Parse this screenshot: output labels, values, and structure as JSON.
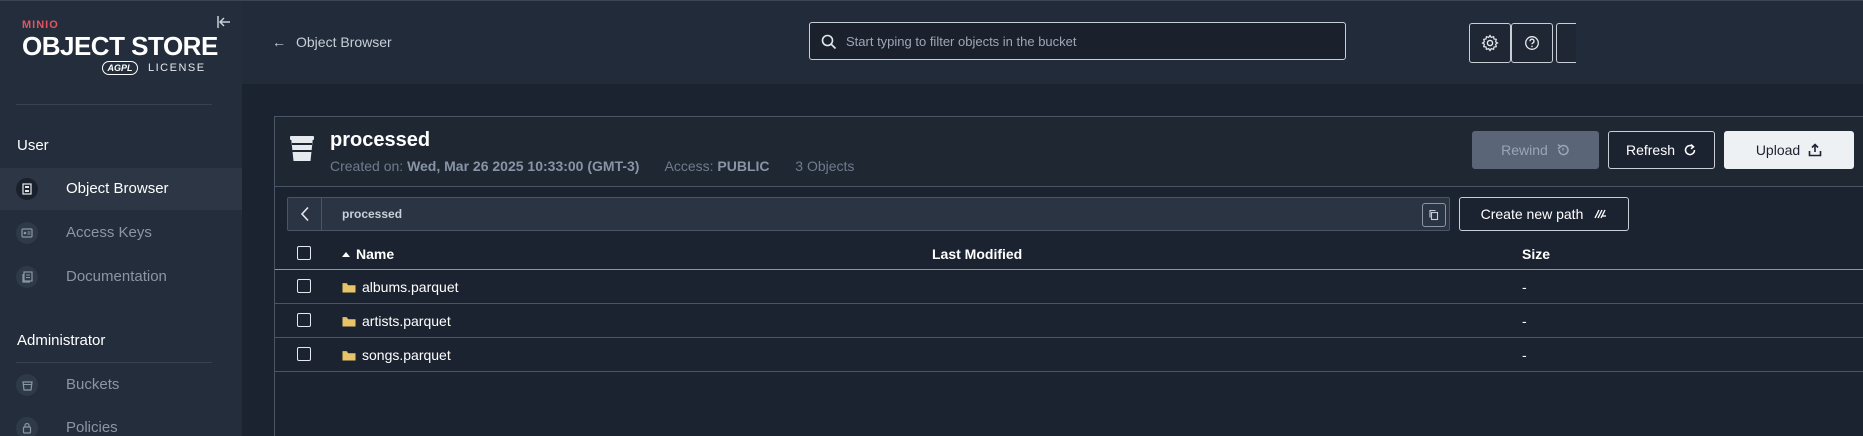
{
  "sidebar": {
    "logo": {
      "brand": "MINIO",
      "product": "OBJECT STORE",
      "badge": "AGPL",
      "license": "LICENSE"
    },
    "sections": [
      {
        "label": "User"
      },
      {
        "label": "Administrator"
      }
    ],
    "items": [
      {
        "label": "Object Browser",
        "icon": "object-browser-icon",
        "active": true
      },
      {
        "label": "Access Keys",
        "icon": "access-keys-icon",
        "active": false
      },
      {
        "label": "Documentation",
        "icon": "documentation-icon",
        "active": false
      },
      {
        "label": "Buckets",
        "icon": "buckets-icon",
        "active": false
      },
      {
        "label": "Policies",
        "icon": "policies-icon",
        "active": false
      }
    ]
  },
  "topbar": {
    "breadcrumb": "Object Browser",
    "search_placeholder": "Start typing to filter objects in the bucket",
    "icons": [
      "settings-icon",
      "help-icon"
    ]
  },
  "bucket": {
    "name": "processed",
    "created_label": "Created on:",
    "created_value": "Wed, Mar 26 2025 10:33:00 (GMT-3)",
    "access_label": "Access:",
    "access_value": "PUBLIC",
    "objects_count": "3 Objects",
    "buttons": {
      "rewind": "Rewind",
      "refresh": "Refresh",
      "upload": "Upload"
    }
  },
  "path": {
    "current": "processed",
    "new_path_label": "Create new path"
  },
  "table": {
    "columns": {
      "name": "Name",
      "last_modified": "Last Modified",
      "size": "Size"
    },
    "rows": [
      {
        "name": "albums.parquet",
        "last_modified": "",
        "size": "-"
      },
      {
        "name": "artists.parquet",
        "last_modified": "",
        "size": "-"
      },
      {
        "name": "songs.parquet",
        "last_modified": "",
        "size": "-"
      }
    ]
  },
  "colors": {
    "background": "#1c2330",
    "sidebar": "#232d3b",
    "brand_red": "#e35460",
    "folder": "#e8c468"
  }
}
